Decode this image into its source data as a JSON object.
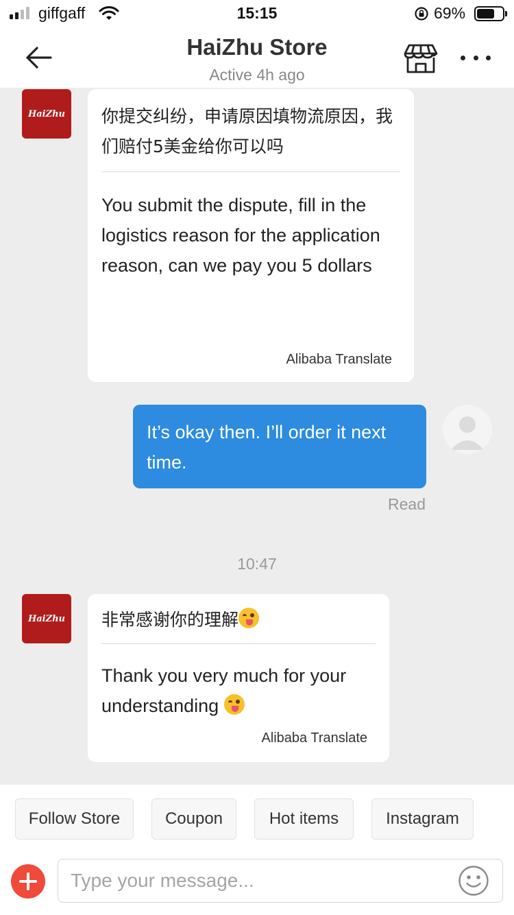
{
  "status_bar": {
    "carrier": "giffgaff",
    "time": "15:15",
    "battery_percent": "69%",
    "battery_level": 0.69,
    "signal_bars_filled": 2,
    "signal_bars_total": 4,
    "icons": [
      "signal-icon",
      "wifi-icon",
      "orientation-lock-icon",
      "battery-icon"
    ]
  },
  "header": {
    "back_icon": "arrow-left-icon",
    "title": "HaiZhu Store",
    "subtitle": "Active 4h ago",
    "store_icon": "storefront-icon",
    "more_icon": "more-horizontal-icon"
  },
  "messages": [
    {
      "direction": "incoming",
      "avatar_text": "HaiZhu",
      "original": "你提交纠纷，申请原因填物流原因，我们赔付5美金给你可以吗",
      "translation": "You submit the dispute, fill in the logistics reason for the application reason, can we pay you 5 dollars",
      "translate_credit": "Alibaba Translate"
    },
    {
      "direction": "outgoing",
      "text": "It’s okay then. I’ll order it next time.",
      "status": "Read"
    },
    {
      "type": "timestamp",
      "text": "10:47"
    },
    {
      "direction": "incoming",
      "avatar_text": "HaiZhu",
      "original": "非常感谢你的理解",
      "translation": "Thank you very much for your understanding",
      "translate_credit": "Alibaba Translate",
      "emoji": "winking-tongue-emoji"
    }
  ],
  "quick_replies": [
    "Follow Store",
    "Coupon",
    "Hot items",
    "Instagram"
  ],
  "composer": {
    "placeholder": "Type your message...",
    "value": "",
    "add_icon": "plus-circle-icon",
    "emoji_icon": "smiley-icon"
  },
  "colors": {
    "accent_blue": "#2d8be0",
    "add_red": "#f04a3b",
    "store_red": "#b01c1c",
    "chat_background": "#ededed"
  }
}
